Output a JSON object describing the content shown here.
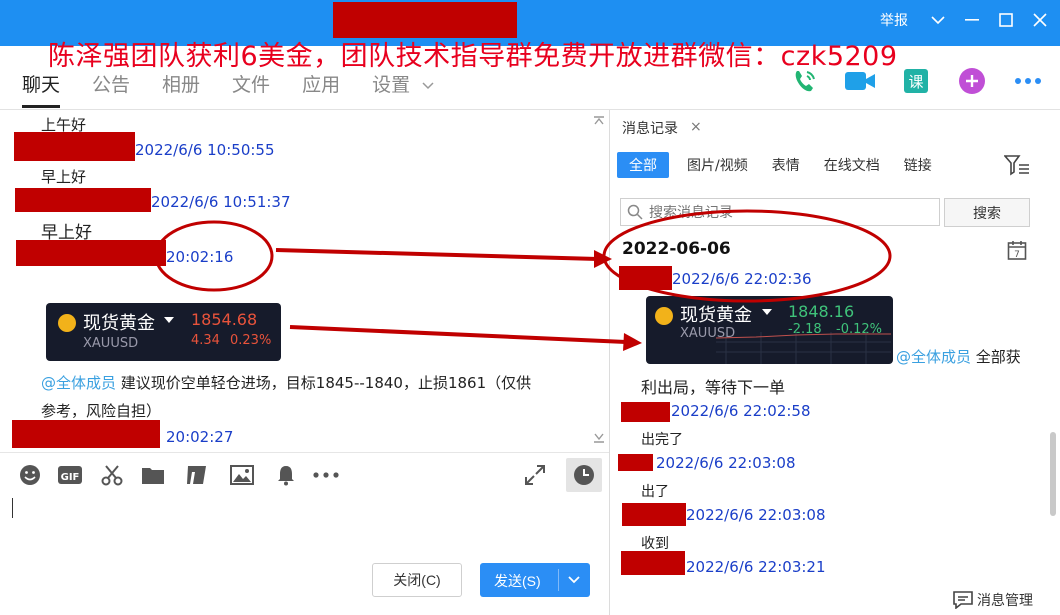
{
  "titlebar": {
    "overlay_text": "陈泽强团队获利6美金，团队技术指导群免费开放进群微信：czk5209",
    "report_label": "举报"
  },
  "nav": {
    "tabs": [
      "聊天",
      "公告",
      "相册",
      "文件",
      "应用",
      "设置"
    ]
  },
  "chat": {
    "messages": [
      {
        "text": "上午好",
        "time": "2022/6/6 10:50:55"
      },
      {
        "text": "早上好",
        "time": "2022/6/6 10:51:37"
      },
      {
        "text": "早上好",
        "time": "20:02:16"
      }
    ],
    "gold_card": {
      "name": "现货黄金",
      "symbol": "XAUUSD",
      "price": "1854.68",
      "change": "4.34",
      "percent": "0.23%"
    },
    "advice": {
      "mention": "@全体成员",
      "line1": " 建议现价空单轻仓进场，目标1845--1840，止损1861（仅供",
      "line2": "参考，风险自担）",
      "time": "20:02:27"
    }
  },
  "composer": {
    "close_label": "关闭(C)",
    "send_label": "发送(S)"
  },
  "history": {
    "tab_label": "消息记录",
    "filters": [
      "全部",
      "图片/视频",
      "表情",
      "在线文档",
      "链接"
    ],
    "search_placeholder": "搜索消息记录",
    "search_button": "搜索",
    "date_header": "2022-06-06",
    "first_time": "2022/6/6 22:02:36",
    "gold_card": {
      "name": "现货黄金",
      "symbol": "XAUUSD",
      "price": "1848.16",
      "change": "-2.18",
      "percent": "-0.12%"
    },
    "mention": "@全体成员",
    "mention_text": " 全部获",
    "line2": "利出局，等待下一单",
    "entries": [
      {
        "time": "2022/6/6 22:02:58",
        "text": "出完了"
      },
      {
        "time": "2022/6/6 22:03:08",
        "text": "出了"
      },
      {
        "time": "2022/6/6 22:03:08",
        "text": "收到"
      },
      {
        "time": "2022/6/6 22:03:21",
        "text": ""
      }
    ],
    "manage_label": "消息管理"
  },
  "colors": {
    "titlebar": "#1e8ff2",
    "redaction": "#c00000",
    "annotation": "#c00000",
    "time_text": "#1a3ec8",
    "mention": "#3aa0e0",
    "accent": "#2b8ef5"
  }
}
